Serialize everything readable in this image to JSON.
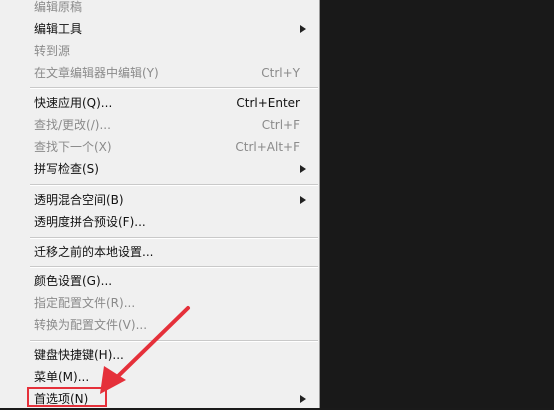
{
  "menu": {
    "items": [
      {
        "label": "编辑原稿",
        "shortcut": "",
        "disabled": true,
        "submenu": false
      },
      {
        "label": "编辑工具",
        "shortcut": "",
        "disabled": false,
        "submenu": true
      },
      {
        "label": "转到源",
        "shortcut": "",
        "disabled": true,
        "submenu": false
      },
      {
        "label": "在文章编辑器中编辑(Y)",
        "shortcut": "Ctrl+Y",
        "disabled": true,
        "submenu": false
      },
      {
        "label": "快速应用(Q)...",
        "shortcut": "Ctrl+Enter",
        "disabled": false,
        "submenu": false
      },
      {
        "label": "查找/更改(/)...",
        "shortcut": "Ctrl+F",
        "disabled": true,
        "submenu": false
      },
      {
        "label": "查找下一个(X)",
        "shortcut": "Ctrl+Alt+F",
        "disabled": true,
        "submenu": false
      },
      {
        "label": "拼写检查(S)",
        "shortcut": "",
        "disabled": false,
        "submenu": true
      },
      {
        "label": "透明混合空间(B)",
        "shortcut": "",
        "disabled": false,
        "submenu": true
      },
      {
        "label": "透明度拼合预设(F)...",
        "shortcut": "",
        "disabled": false,
        "submenu": false
      },
      {
        "label": "迁移之前的本地设置...",
        "shortcut": "",
        "disabled": false,
        "submenu": false
      },
      {
        "label": "颜色设置(G)...",
        "shortcut": "",
        "disabled": false,
        "submenu": false
      },
      {
        "label": "指定配置文件(R)...",
        "shortcut": "",
        "disabled": true,
        "submenu": false
      },
      {
        "label": "转换为配置文件(V)...",
        "shortcut": "",
        "disabled": true,
        "submenu": false
      },
      {
        "label": "键盘快捷键(H)...",
        "shortcut": "",
        "disabled": false,
        "submenu": false
      },
      {
        "label": "菜单(M)...",
        "shortcut": "",
        "disabled": false,
        "submenu": false
      },
      {
        "label": "首选项(N)",
        "shortcut": "",
        "disabled": false,
        "submenu": true
      }
    ]
  },
  "colors": {
    "menu_bg": "#f0f0f0",
    "disabled_text": "#8a8a8a",
    "annotation_red": "#e5303a",
    "background": "#191919"
  },
  "icons": {
    "submenu": "chevron-right-icon",
    "annotation": "red-arrow-icon"
  }
}
